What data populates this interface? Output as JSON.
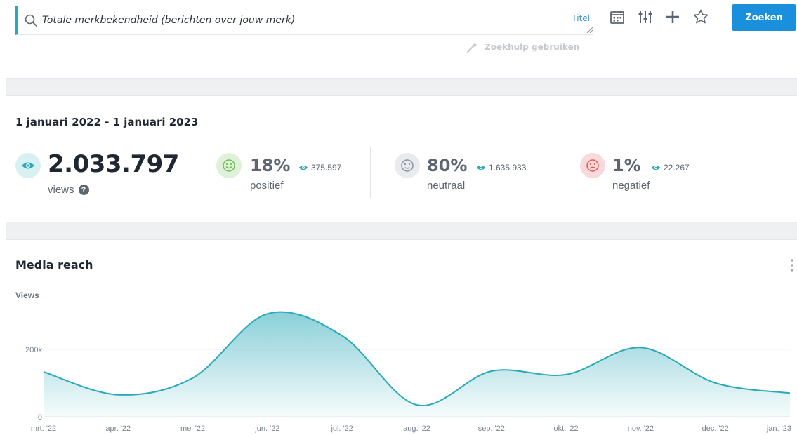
{
  "search": {
    "value": "Totale merkbekendheid (berichten over jouw merk)",
    "field_tag": "Titel",
    "submit_label": "Zoeken",
    "helper_label": "Zoekhulp gebruiken"
  },
  "toolbar": {
    "icons": [
      "calendar-icon",
      "sliders-icon",
      "plus-icon",
      "star-icon"
    ]
  },
  "summary": {
    "date_range": "1 januari 2022 - 1 januari 2023",
    "total_views": "2.033.797",
    "total_label": "views",
    "help_glyph": "?",
    "sentiments": [
      {
        "percent": "18%",
        "count": "375.597",
        "label": "positief",
        "color": "#8ccc7a",
        "bg": "#dff1d8"
      },
      {
        "percent": "80%",
        "count": "1.635.933",
        "label": "neutraal",
        "color": "#8a929c",
        "bg": "#e9ebee"
      },
      {
        "percent": "1%",
        "count": "22.267",
        "label": "negatief",
        "color": "#e05a5a",
        "bg": "#f9d9d9"
      }
    ],
    "accent": "#2aa9b8"
  },
  "chart": {
    "title": "Media reach",
    "y_title": "Views"
  },
  "chart_data": {
    "type": "area",
    "title": "Media reach",
    "ylabel": "Views",
    "x": [
      "mrt. '22",
      "apr. '22",
      "mei '22",
      "jun. '22",
      "jul. '22",
      "aug. '22",
      "sep. '22",
      "okt. '22",
      "nov. '22",
      "dec. '22",
      "jan. '23"
    ],
    "series": [
      {
        "values": [
          133000,
          65000,
          115000,
          305000,
          240000,
          35000,
          135000,
          125000,
          205000,
          100000,
          70000
        ]
      }
    ],
    "y_ticks": [
      0,
      200000
    ],
    "y_tick_labels": [
      "0",
      "200k"
    ],
    "ylim": [
      0,
      320000
    ],
    "grid": true,
    "color": "#2aa9b8"
  }
}
